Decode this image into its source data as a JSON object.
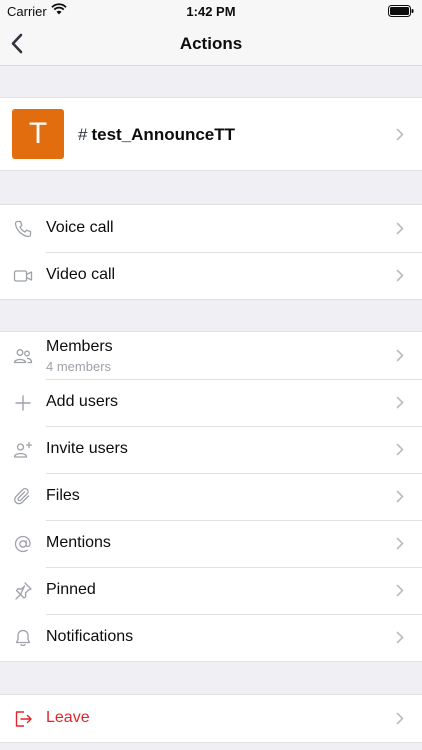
{
  "status": {
    "carrier": "Carrier",
    "time": "1:42 PM"
  },
  "nav": {
    "title": "Actions"
  },
  "room": {
    "avatar_letter": "T",
    "hash": "#",
    "name": "test_AnnounceTT"
  },
  "calls": [
    {
      "label": "Voice call",
      "icon": "phone-icon"
    },
    {
      "label": "Video call",
      "icon": "video-camera-icon"
    }
  ],
  "room_actions": {
    "members": {
      "label": "Members",
      "sub": "4 members"
    },
    "add_users": "Add users",
    "invite_users": "Invite users",
    "files": "Files",
    "mentions": "Mentions",
    "pinned": "Pinned",
    "notifications": "Notifications"
  },
  "leave": {
    "label": "Leave"
  },
  "colors": {
    "avatar": "#e26d0e",
    "danger": "#e0252c",
    "background": "#efeff4",
    "icon": "#9ea2a8"
  }
}
